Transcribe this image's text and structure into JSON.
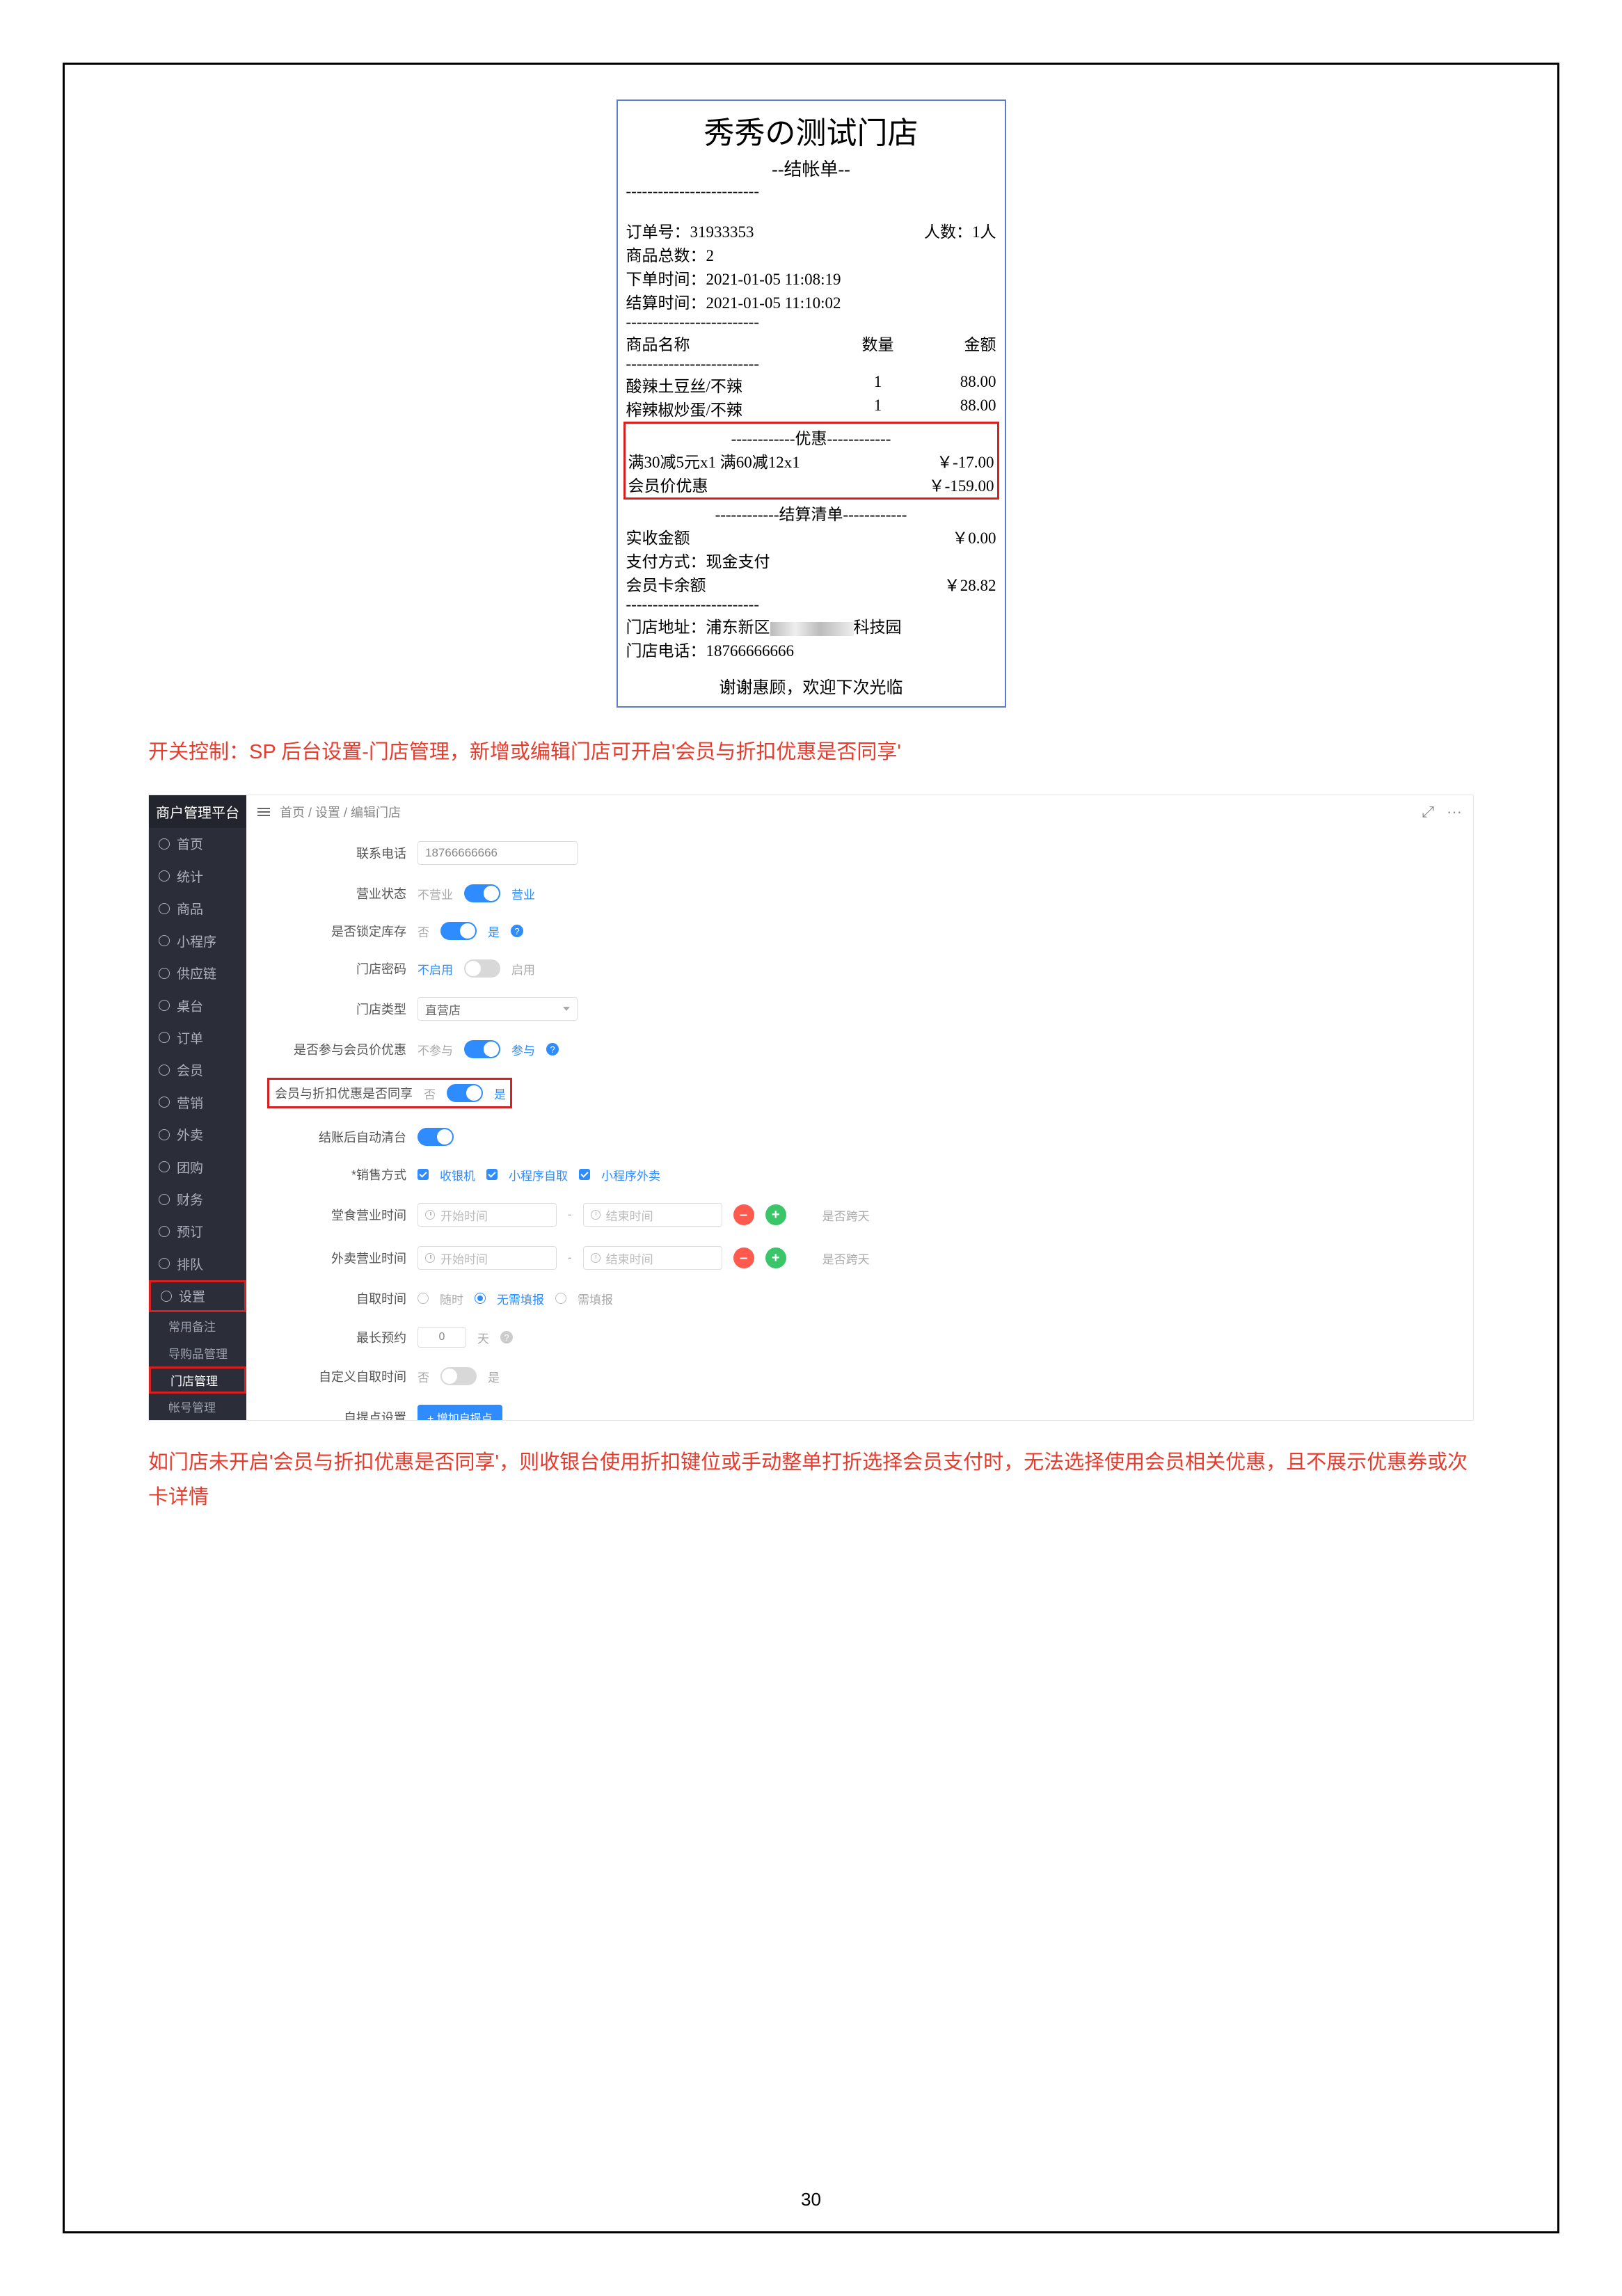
{
  "receipt": {
    "shop_title": "秀秀の测试门店",
    "subtitle": "--结帐单--",
    "order_no_label": "订单号：",
    "order_no": "31933353",
    "people_label": "人数：",
    "people": "1人",
    "goods_count_label": "商品总数：",
    "goods_count": "2",
    "order_time_label": "下单时间：",
    "order_time": "2021-01-05 11:08:19",
    "settle_time_label": "结算时间：",
    "settle_time": "2021-01-05 11:10:02",
    "header_name": "商品名称",
    "header_qty": "数量",
    "header_amount": "金额",
    "items": [
      {
        "name": "酸辣土豆丝/不辣",
        "qty": "1",
        "amount": "88.00"
      },
      {
        "name": "榨辣椒炒蛋/不辣",
        "qty": "1",
        "amount": "88.00"
      }
    ],
    "promo_divider": "------------优惠------------",
    "promo_line": "满30减5元x1 满60减12x1",
    "promo_value": "￥-17.00",
    "member_price_label": "会员价优惠",
    "member_price_value": "￥-159.00",
    "settle_divider": "------------结算清单------------",
    "received_label": "实收金额",
    "received_value": "￥0.00",
    "pay_method_label": "支付方式：",
    "pay_method": "现金支付",
    "member_balance_label": "会员卡余额",
    "member_balance_value": "￥28.82",
    "address_label": "门店地址：",
    "address_prefix": "浦东新区",
    "address_suffix": "科技园",
    "phone_label": "门店电话：",
    "phone": "18766666666",
    "thanks": "谢谢惠顾，欢迎下次光临"
  },
  "note1": "开关控制：SP 后台设置-门店管理，新增或编辑门店可开启'会员与折扣优惠是否同享'",
  "note2": "如门店未开启'会员与折扣优惠是否同享'，则收银台使用折扣键位或手动整单打折选择会员支付时，无法选择使用会员相关优惠，且不展示优惠券或次卡详情",
  "admin": {
    "brand": "商户管理平台",
    "topbar_right_expand": "⤢",
    "topbar_right_more": "···",
    "breadcrumb": "首页 / 设置 / 编辑门店",
    "sidebar": [
      "首页",
      "统计",
      "商品",
      "小程序",
      "供应链",
      "桌台",
      "订单",
      "会员",
      "营销",
      "外卖",
      "团购",
      "财务",
      "预订",
      "排队",
      "设置"
    ],
    "sub_items": [
      "常用备注",
      "导购品管理",
      "门店管理",
      "帐号管理"
    ],
    "form": {
      "phone_label": "联系电话",
      "phone": "18766666666",
      "status_label": "营业状态",
      "status_off": "不营业",
      "status_on": "营业",
      "lock_stock_label": "是否锁定库存",
      "no": "否",
      "yes": "是",
      "store_pwd_label": "门店密码",
      "disabled": "不启用",
      "enabled": "启用",
      "store_type_label": "门店类型",
      "store_type": "直营店",
      "member_price_participate_label": "是否参与会员价优惠",
      "not_participate": "不参与",
      "participate": "参与",
      "member_discount_share_label": "会员与折扣优惠是否同享",
      "auto_clear_label": "结账后自动清台",
      "sale_mode_label": "*销售方式",
      "sale_mode_1": "收银机",
      "sale_mode_2": "小程序自取",
      "sale_mode_3": "小程序外卖",
      "dine_time_label": "堂食营业时间",
      "delivery_time_label": "外卖营业时间",
      "start_placeholder": "开始时间",
      "end_placeholder": "结束时间",
      "cross_day": "是否跨天",
      "pickup_time_label": "自取时间",
      "pickup_opt1": "随时",
      "pickup_opt2": "无需填报",
      "pickup_opt3": "需填报",
      "max_reserve_label": "最长预约",
      "max_reserve_value": "0",
      "days_unit": "天",
      "custom_pickup_label": "自定义自取时间",
      "pickup_point_label": "自提点设置",
      "add_point_btn": "+ 增加自提点"
    }
  },
  "page_number": "30"
}
